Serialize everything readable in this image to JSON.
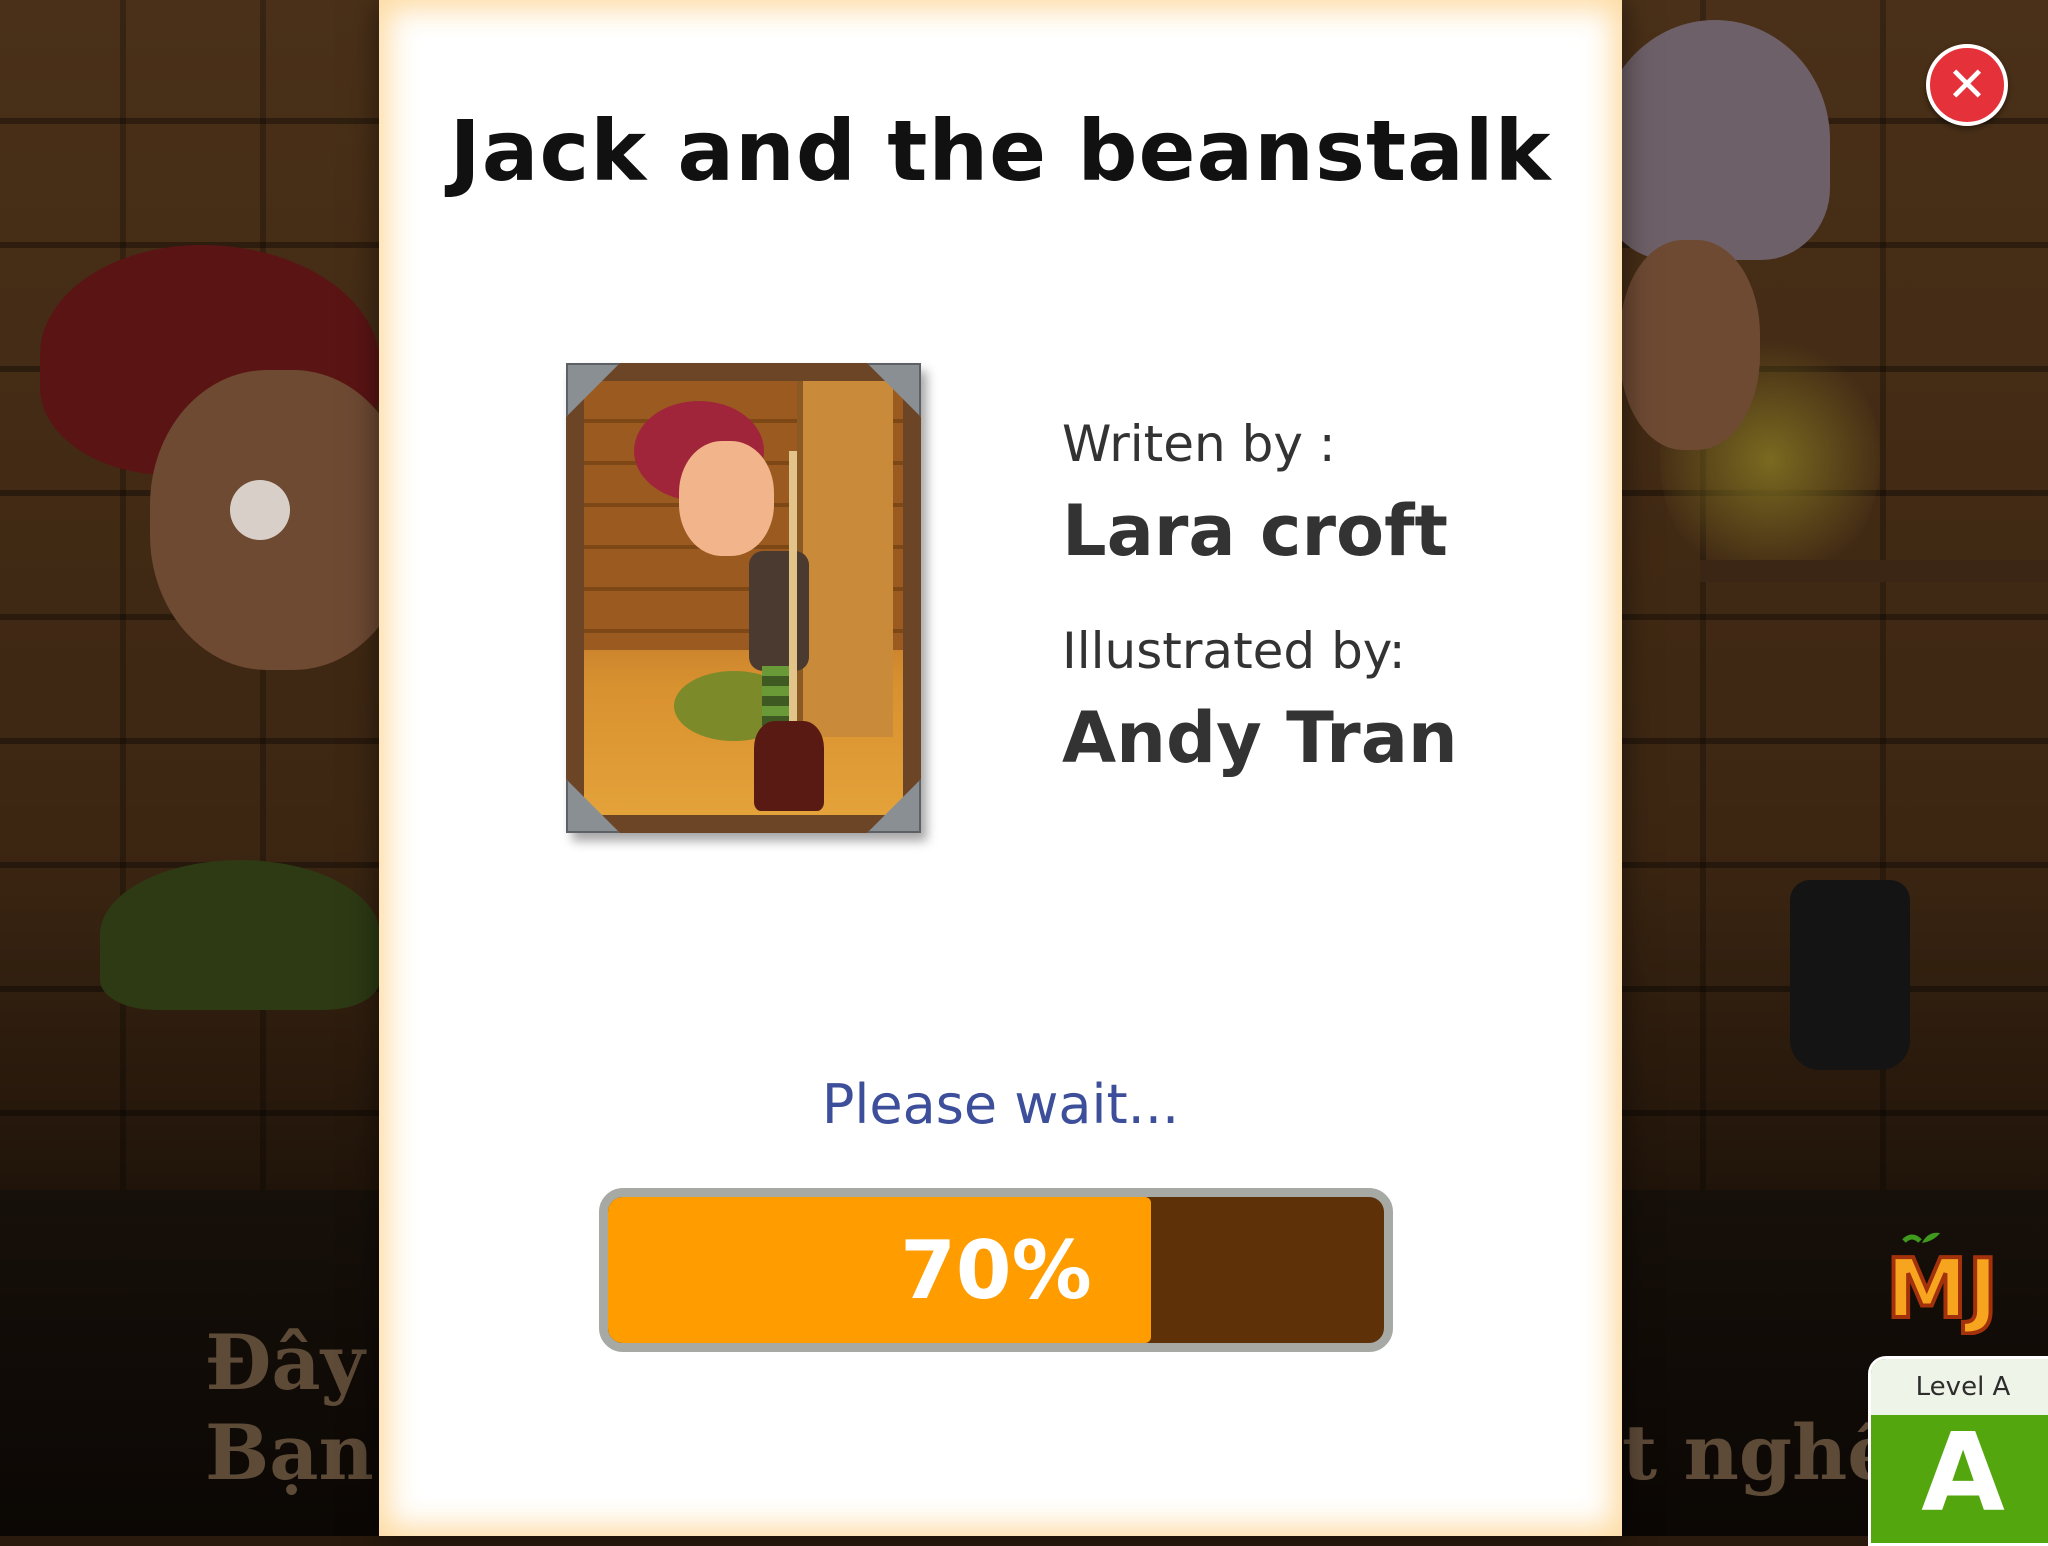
{
  "book": {
    "title": "Jack and the beanstalk",
    "written_label": "Writen by :",
    "author": "Lara croft",
    "illustrated_label": "Illustrated by:",
    "illustrator": "Andy Tran"
  },
  "loading": {
    "message": "Please wait...",
    "progress_percent": 70,
    "progress_label": "70%"
  },
  "background_subtitle": {
    "line1_left": "Đây",
    "line2_left": "Bạn",
    "line2_right": "t nghề"
  },
  "close_button": {
    "symbol": "✕",
    "icon": "close-icon"
  },
  "brand": {
    "logo_text": "MJ"
  },
  "level_badge": {
    "label": "Level A",
    "letter": "A"
  },
  "colors": {
    "progress_fill": "#ff9c00",
    "progress_track": "#5e3109",
    "close_button": "#e5313a",
    "level_badge": "#53a60d",
    "wait_text": "#3d4f9a"
  }
}
